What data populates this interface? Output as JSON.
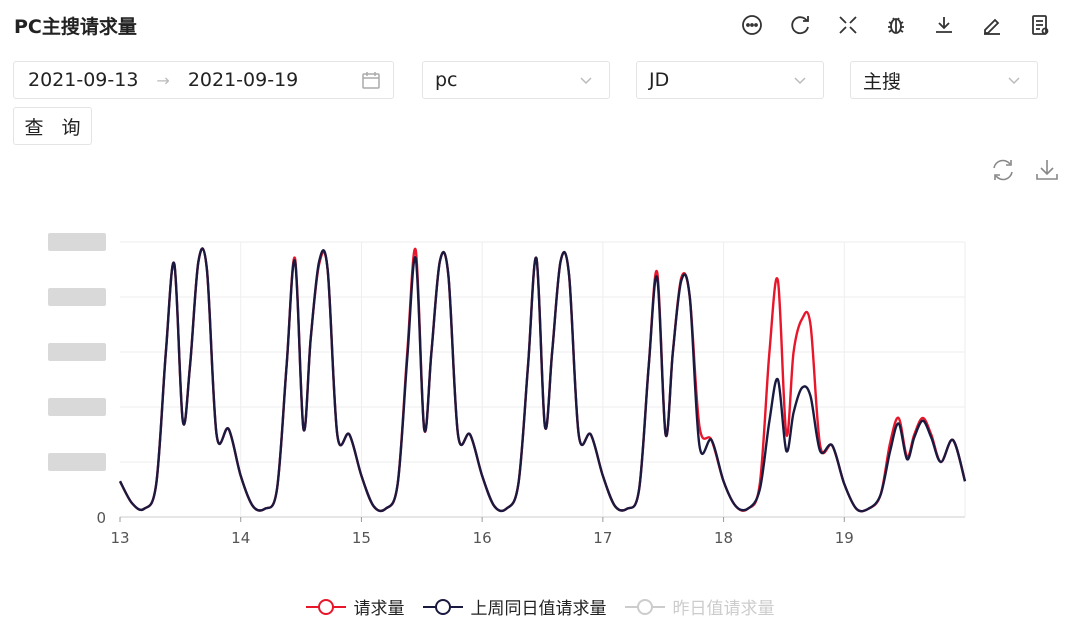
{
  "header": {
    "title": "PC主搜请求量",
    "icons": [
      "comment-icon",
      "refresh-icon",
      "fullscreen-icon",
      "bug-icon",
      "download-icon",
      "edit-icon",
      "report-icon"
    ]
  },
  "filters": {
    "start_date": "2021-09-13",
    "end_date": "2021-09-19",
    "platform": "pc",
    "site": "JD",
    "search_type": "主搜"
  },
  "query_button": "查 询",
  "chart_data": {
    "type": "line",
    "x_label": "",
    "y_label": "",
    "x_ticks": [
      "13",
      "14",
      "15",
      "16",
      "17",
      "18",
      "19"
    ],
    "y_ticks": [
      "0"
    ],
    "x_range": [
      13,
      20
    ],
    "y_range": [
      0,
      1
    ],
    "y_tick_labels_blurred": true,
    "grid": true,
    "legend_position": "bottom",
    "series": [
      {
        "name": "请求量",
        "color": "#e8162b",
        "points": [
          [
            13.0,
            0.13
          ],
          [
            13.1,
            0.05
          ],
          [
            13.2,
            0.03
          ],
          [
            13.3,
            0.12
          ],
          [
            13.38,
            0.6
          ],
          [
            13.45,
            0.92
          ],
          [
            13.52,
            0.35
          ],
          [
            13.58,
            0.55
          ],
          [
            13.65,
            0.93
          ],
          [
            13.72,
            0.9
          ],
          [
            13.8,
            0.3
          ],
          [
            13.9,
            0.32
          ],
          [
            14.0,
            0.15
          ],
          [
            14.1,
            0.04
          ],
          [
            14.2,
            0.03
          ],
          [
            14.3,
            0.1
          ],
          [
            14.38,
            0.55
          ],
          [
            14.45,
            0.94
          ],
          [
            14.52,
            0.32
          ],
          [
            14.58,
            0.65
          ],
          [
            14.65,
            0.92
          ],
          [
            14.72,
            0.9
          ],
          [
            14.8,
            0.3
          ],
          [
            14.9,
            0.3
          ],
          [
            15.0,
            0.15
          ],
          [
            15.1,
            0.04
          ],
          [
            15.2,
            0.03
          ],
          [
            15.3,
            0.12
          ],
          [
            15.38,
            0.6
          ],
          [
            15.45,
            0.97
          ],
          [
            15.52,
            0.32
          ],
          [
            15.58,
            0.6
          ],
          [
            15.65,
            0.93
          ],
          [
            15.72,
            0.88
          ],
          [
            15.8,
            0.3
          ],
          [
            15.9,
            0.3
          ],
          [
            16.0,
            0.15
          ],
          [
            16.1,
            0.04
          ],
          [
            16.2,
            0.03
          ],
          [
            16.3,
            0.12
          ],
          [
            16.38,
            0.55
          ],
          [
            16.45,
            0.94
          ],
          [
            16.52,
            0.33
          ],
          [
            16.58,
            0.6
          ],
          [
            16.65,
            0.93
          ],
          [
            16.72,
            0.88
          ],
          [
            16.8,
            0.3
          ],
          [
            16.9,
            0.3
          ],
          [
            17.0,
            0.15
          ],
          [
            17.1,
            0.04
          ],
          [
            17.2,
            0.03
          ],
          [
            17.3,
            0.1
          ],
          [
            17.38,
            0.55
          ],
          [
            17.45,
            0.89
          ],
          [
            17.52,
            0.3
          ],
          [
            17.58,
            0.6
          ],
          [
            17.65,
            0.87
          ],
          [
            17.72,
            0.8
          ],
          [
            17.8,
            0.33
          ],
          [
            17.9,
            0.28
          ],
          [
            18.0,
            0.13
          ],
          [
            18.1,
            0.04
          ],
          [
            18.2,
            0.03
          ],
          [
            18.3,
            0.12
          ],
          [
            18.38,
            0.6
          ],
          [
            18.45,
            0.86
          ],
          [
            18.52,
            0.3
          ],
          [
            18.58,
            0.6
          ],
          [
            18.65,
            0.72
          ],
          [
            18.72,
            0.7
          ],
          [
            18.8,
            0.26
          ],
          [
            18.9,
            0.26
          ],
          [
            19.0,
            0.12
          ],
          [
            19.1,
            0.03
          ],
          [
            19.2,
            0.03
          ],
          [
            19.3,
            0.08
          ],
          [
            19.38,
            0.27
          ],
          [
            19.45,
            0.36
          ],
          [
            19.52,
            0.22
          ],
          [
            19.58,
            0.3
          ],
          [
            19.65,
            0.36
          ],
          [
            19.72,
            0.3
          ],
          [
            19.8,
            0.2
          ],
          [
            19.9,
            0.28
          ],
          [
            20.0,
            0.13
          ]
        ]
      },
      {
        "name": "上周同日值请求量",
        "color": "#1a1a40",
        "points": [
          [
            13.0,
            0.13
          ],
          [
            13.1,
            0.05
          ],
          [
            13.2,
            0.03
          ],
          [
            13.3,
            0.12
          ],
          [
            13.38,
            0.6
          ],
          [
            13.45,
            0.92
          ],
          [
            13.52,
            0.35
          ],
          [
            13.58,
            0.55
          ],
          [
            13.65,
            0.93
          ],
          [
            13.72,
            0.9
          ],
          [
            13.8,
            0.3
          ],
          [
            13.9,
            0.32
          ],
          [
            14.0,
            0.15
          ],
          [
            14.1,
            0.04
          ],
          [
            14.2,
            0.03
          ],
          [
            14.3,
            0.1
          ],
          [
            14.38,
            0.55
          ],
          [
            14.45,
            0.93
          ],
          [
            14.52,
            0.32
          ],
          [
            14.58,
            0.65
          ],
          [
            14.65,
            0.93
          ],
          [
            14.72,
            0.9
          ],
          [
            14.8,
            0.3
          ],
          [
            14.9,
            0.3
          ],
          [
            15.0,
            0.15
          ],
          [
            15.1,
            0.04
          ],
          [
            15.2,
            0.03
          ],
          [
            15.3,
            0.12
          ],
          [
            15.38,
            0.58
          ],
          [
            15.45,
            0.94
          ],
          [
            15.52,
            0.32
          ],
          [
            15.58,
            0.6
          ],
          [
            15.65,
            0.93
          ],
          [
            15.72,
            0.88
          ],
          [
            15.8,
            0.3
          ],
          [
            15.9,
            0.3
          ],
          [
            16.0,
            0.15
          ],
          [
            16.1,
            0.04
          ],
          [
            16.2,
            0.03
          ],
          [
            16.3,
            0.12
          ],
          [
            16.38,
            0.55
          ],
          [
            16.45,
            0.94
          ],
          [
            16.52,
            0.33
          ],
          [
            16.58,
            0.6
          ],
          [
            16.65,
            0.93
          ],
          [
            16.72,
            0.88
          ],
          [
            16.8,
            0.3
          ],
          [
            16.9,
            0.3
          ],
          [
            17.0,
            0.15
          ],
          [
            17.1,
            0.04
          ],
          [
            17.2,
            0.03
          ],
          [
            17.3,
            0.1
          ],
          [
            17.38,
            0.55
          ],
          [
            17.45,
            0.87
          ],
          [
            17.52,
            0.3
          ],
          [
            17.58,
            0.6
          ],
          [
            17.65,
            0.86
          ],
          [
            17.72,
            0.8
          ],
          [
            17.8,
            0.26
          ],
          [
            17.9,
            0.28
          ],
          [
            18.0,
            0.13
          ],
          [
            18.1,
            0.04
          ],
          [
            18.2,
            0.03
          ],
          [
            18.3,
            0.1
          ],
          [
            18.38,
            0.35
          ],
          [
            18.45,
            0.5
          ],
          [
            18.52,
            0.24
          ],
          [
            18.58,
            0.38
          ],
          [
            18.65,
            0.47
          ],
          [
            18.72,
            0.44
          ],
          [
            18.8,
            0.24
          ],
          [
            18.9,
            0.26
          ],
          [
            19.0,
            0.12
          ],
          [
            19.1,
            0.03
          ],
          [
            19.2,
            0.03
          ],
          [
            19.3,
            0.08
          ],
          [
            19.38,
            0.24
          ],
          [
            19.45,
            0.34
          ],
          [
            19.52,
            0.21
          ],
          [
            19.58,
            0.29
          ],
          [
            19.65,
            0.35
          ],
          [
            19.72,
            0.29
          ],
          [
            19.8,
            0.2
          ],
          [
            19.9,
            0.28
          ],
          [
            20.0,
            0.13
          ]
        ]
      }
    ],
    "legend": [
      {
        "name": "请求量",
        "color": "#e8162b",
        "active": true
      },
      {
        "name": "上周同日值请求量",
        "color": "#1a1a40",
        "active": true
      },
      {
        "name": "昨日值请求量",
        "color": "#cccccc",
        "active": false
      }
    ]
  }
}
